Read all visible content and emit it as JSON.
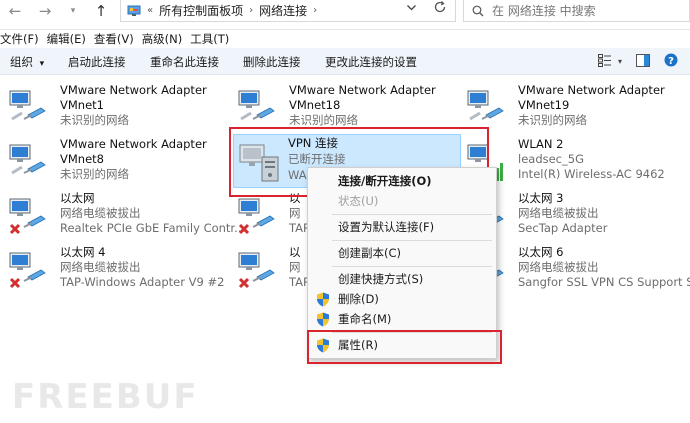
{
  "address": {
    "segments": [
      "所有控制面板项",
      "网络连接"
    ],
    "chevron": "«",
    "separator": "›",
    "refresh_icon": "refresh-icon",
    "dropdown_icon": "chevron-down-icon"
  },
  "search": {
    "placeholder": "在 网络连接 中搜索"
  },
  "menu": [
    "文件(F)",
    "编辑(E)",
    "查看(V)",
    "高级(N)",
    "工具(T)"
  ],
  "commands": {
    "organize": "组织",
    "organize_arrow": "▾",
    "start": "启动此连接",
    "rename": "重命名此连接",
    "delete": "删除此连接",
    "change": "更改此连接的设置"
  },
  "connections": [
    {
      "name": "VMware Network Adapter",
      "name2": "VMnet1",
      "status": "未识别的网络",
      "device": ""
    },
    {
      "name": "VMware Network Adapter",
      "name2": "VMnet18",
      "status": "未识别的网络",
      "device": ""
    },
    {
      "name": "VMware Network Adapter",
      "name2": "VMnet19",
      "status": "未识别的网络",
      "device": ""
    },
    {
      "name": "VMware Network Adapter",
      "name2": "VMnet8",
      "status": "未识别的网络",
      "device": ""
    },
    {
      "name": "VPN 连接",
      "status": "已断开连接",
      "device": "WA"
    },
    {
      "name": "WLAN 2",
      "status": "leadsec_5G",
      "device": "Intel(R) Wireless-AC 9462"
    },
    {
      "name": "以太网",
      "status": "网络电缆被拔出",
      "device": "Realtek PCIe GbE Family Contr..."
    },
    {
      "name": "以",
      "status": "网",
      "device": "TAP"
    },
    {
      "name": "以太网 3",
      "status": "网络电缆被拔出",
      "device": "SecTap Adapter"
    },
    {
      "name": "以太网 4",
      "status": "网络电缆被拔出",
      "device": "TAP-Windows Adapter V9 #2"
    },
    {
      "name": "以",
      "status": "网",
      "device": "TAP"
    },
    {
      "name": "以太网 6",
      "status": "网络电缆被拔出",
      "device": "Sangfor SSL VPN CS Support S..."
    }
  ],
  "context_menu": {
    "connect": "连接/断开连接(O)",
    "status": "状态(U)",
    "set_default": "设置为默认连接(F)",
    "create_copy": "创建副本(C)",
    "create_shortcut": "创建快捷方式(S)",
    "delete": "删除(D)",
    "rename": "重命名(M)",
    "properties": "属性(R)"
  },
  "watermark": "FREEBUF",
  "colors": {
    "selection": "#cce8ff",
    "highlight": "#d9232f",
    "error": "#d32f2f",
    "command_bar": "#f0f5fb"
  }
}
